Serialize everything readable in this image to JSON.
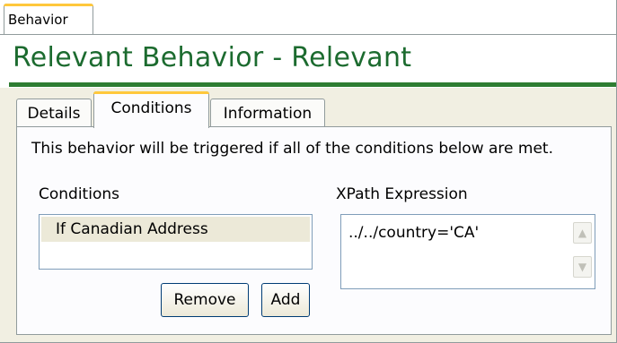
{
  "outer_tab": {
    "label": "Behavior"
  },
  "page_title": "Relevant Behavior - Relevant",
  "tabs": [
    {
      "label": "Details",
      "active": false
    },
    {
      "label": "Conditions",
      "active": true
    },
    {
      "label": "Information",
      "active": false
    }
  ],
  "panel": {
    "description": "This behavior will be triggered if all of the conditions below are met.",
    "conditions_label": "Conditions",
    "conditions": [
      {
        "label": "If Canadian Address",
        "selected": true
      }
    ],
    "xpath_label": "XPath Expression",
    "xpath_value": "../../country='CA'",
    "remove_label": "Remove",
    "add_label": "Add"
  },
  "colors": {
    "title": "#1c6b2f",
    "rule": "#2e7d32",
    "tab_highlight": "#ffc83c",
    "selection": "#ece9d8"
  },
  "icons": {
    "scroll_up": "scroll-up-icon",
    "scroll_down": "scroll-down-icon"
  }
}
